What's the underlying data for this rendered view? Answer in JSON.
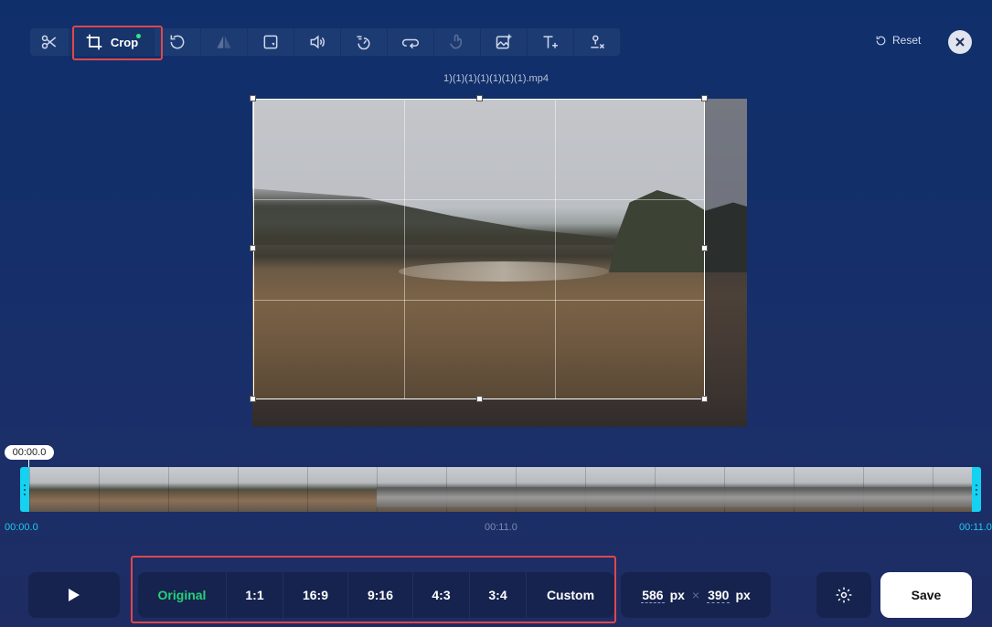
{
  "toolbar": {
    "crop_label": "Crop",
    "tools": [
      "scissors-icon",
      "crop-icon",
      "rotate-icon",
      "flip-icon",
      "crop-frame-icon",
      "volume-icon",
      "speed-icon",
      "loop-icon",
      "touch-icon",
      "image-add-icon",
      "text-add-icon",
      "watermark-remove-icon"
    ]
  },
  "header": {
    "reset_label": "Reset",
    "filename": "1)(1)(1)(1)(1)(1)(1).mp4"
  },
  "timeline": {
    "current_time": "00:00.0",
    "start_label": "00:00.0",
    "mid_label": "00:11.0",
    "end_label": "00:11.0"
  },
  "ratios": [
    {
      "label": "Original",
      "active": true
    },
    {
      "label": "1:1"
    },
    {
      "label": "16:9"
    },
    {
      "label": "9:16"
    },
    {
      "label": "4:3"
    },
    {
      "label": "3:4"
    },
    {
      "label": "Custom"
    }
  ],
  "size": {
    "width": "586",
    "height": "390",
    "unit": "px",
    "separator": "×"
  },
  "save_label": "Save",
  "colors": {
    "accent_green": "#26d27a",
    "highlight_red": "#e0474c",
    "timeline_cyan": "#14d2f0"
  }
}
